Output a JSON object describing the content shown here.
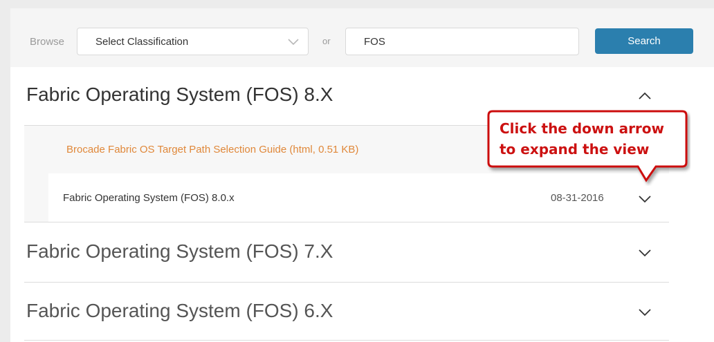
{
  "search": {
    "browse_label": "Browse",
    "classification": {
      "selected": "Select Classification"
    },
    "or_label": "or",
    "query": "FOS",
    "button_label": "Search"
  },
  "sections": [
    {
      "title": "Fabric Operating System (FOS) 8.X",
      "expanded": true,
      "link": "Brocade Fabric OS Target Path Selection Guide (html, 0.51 KB)",
      "rows": [
        {
          "label": "Fabric Operating System (FOS) 8.0.x",
          "date": "08-31-2016"
        }
      ]
    },
    {
      "title": "Fabric Operating System (FOS) 7.X",
      "expanded": false
    },
    {
      "title": "Fabric Operating System (FOS) 6.X",
      "expanded": false
    }
  ],
  "callout": {
    "line1": "Click the down arrow",
    "line2": "to expand the view"
  },
  "colors": {
    "accent_button": "#2b7fae",
    "link": "#e0883a",
    "callout_text": "#cc1111",
    "callout_border": "#cc1111"
  },
  "icons": {
    "select": "chevron-down-icon",
    "expanded_section": "chevron-up-icon",
    "collapsed_section": "chevron-down-icon"
  }
}
